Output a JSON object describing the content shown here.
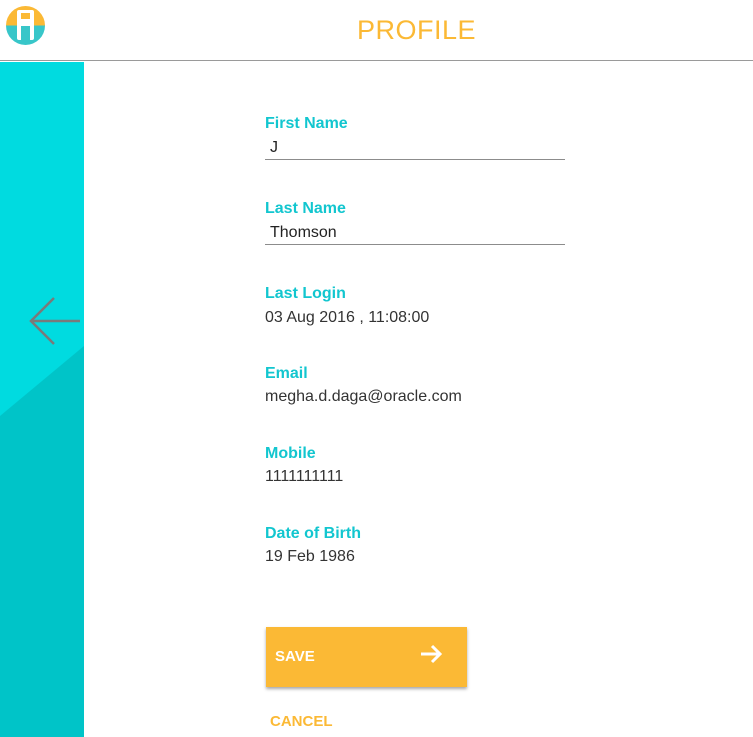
{
  "header": {
    "title": "PROFILE"
  },
  "colors": {
    "accent": "#fbb935",
    "teal": "#00dbe0",
    "label": "#12c6cf"
  },
  "icons": {
    "logo": "logo-icon",
    "back": "arrow-left-icon",
    "save": "arrow-right-icon"
  },
  "form": {
    "first_name": {
      "label": "First Name",
      "value": "J"
    },
    "last_name": {
      "label": "Last Name",
      "value": "Thomson"
    },
    "last_login": {
      "label": "Last Login",
      "value": "03 Aug 2016 , 11:08:00"
    },
    "email": {
      "label": "Email",
      "value": "megha.d.daga@oracle.com"
    },
    "mobile": {
      "label": "Mobile",
      "value": "1111111111"
    },
    "dob": {
      "label": "Date of Birth",
      "value": "19 Feb 1986"
    }
  },
  "actions": {
    "save_label": "SAVE",
    "cancel_label": "CANCEL"
  }
}
